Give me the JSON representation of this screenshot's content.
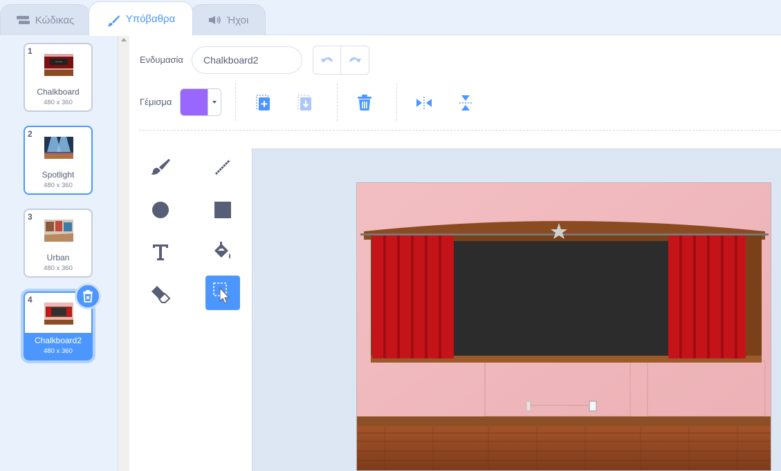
{
  "tabs": [
    {
      "label": "Κώδικας",
      "icon": "code-icon"
    },
    {
      "label": "Υπόβαθρα",
      "icon": "paintbrush-icon"
    },
    {
      "label": "Ήχοι",
      "icon": "speaker-icon"
    }
  ],
  "costumes": [
    {
      "number": "1",
      "name": "Chalkboard",
      "size": "480 x 360"
    },
    {
      "number": "2",
      "name": "Spotlight",
      "size": "480 x 360"
    },
    {
      "number": "3",
      "name": "Urban",
      "size": "480 x 360"
    },
    {
      "number": "4",
      "name": "Chalkboard2",
      "size": "480 x 360"
    }
  ],
  "editor": {
    "costume_label": "Ενδυμασία",
    "costume_name": "Chalkboard2",
    "fill_label": "Γέμισμα",
    "fill_color": "#9966ff"
  },
  "colors": {
    "accent": "#4c97ff",
    "text": "#575e75"
  }
}
